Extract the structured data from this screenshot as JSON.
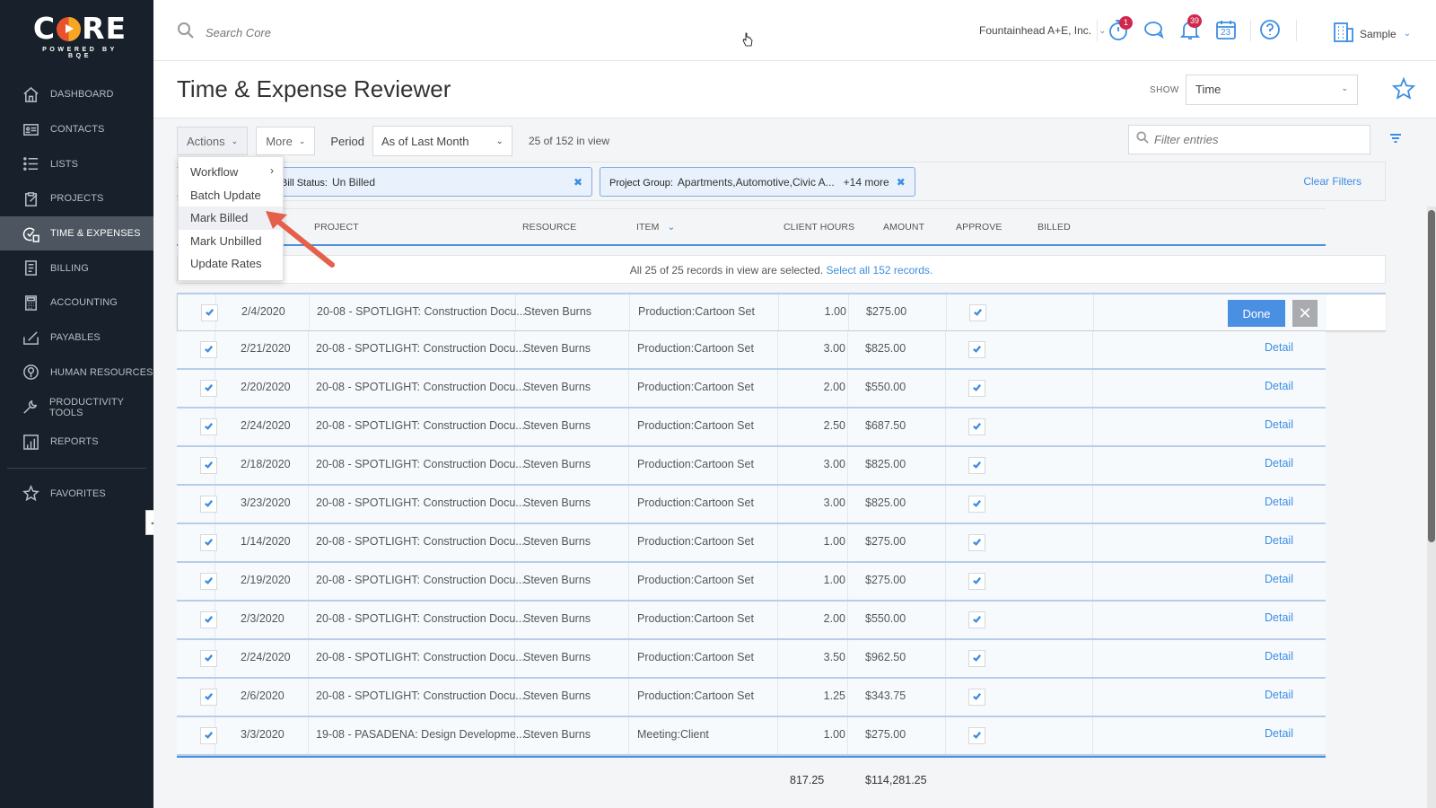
{
  "sidebar": {
    "logo": {
      "word_left": "C",
      "word_right": "RE",
      "tagline": "POWERED BY BQE"
    },
    "items": [
      {
        "label": "DASHBOARD",
        "icon": "home-icon",
        "active": false
      },
      {
        "label": "CONTACTS",
        "icon": "contact-card-icon",
        "active": false
      },
      {
        "label": "LISTS",
        "icon": "list-icon",
        "active": false
      },
      {
        "label": "PROJECTS",
        "icon": "clipboard-edit-icon",
        "active": false
      },
      {
        "label": "TIME & EXPENSES",
        "icon": "clock-dollar-icon",
        "active": true
      },
      {
        "label": "BILLING",
        "icon": "invoice-icon",
        "active": false
      },
      {
        "label": "ACCOUNTING",
        "icon": "calculator-icon",
        "active": false
      },
      {
        "label": "PAYABLES",
        "icon": "check-pen-icon",
        "active": false
      },
      {
        "label": "HUMAN RESOURCES",
        "icon": "person-circle-icon",
        "active": false
      },
      {
        "label": "PRODUCTIVITY TOOLS",
        "icon": "wrench-icon",
        "active": false
      },
      {
        "label": "REPORTS",
        "icon": "chart-icon",
        "active": false
      }
    ],
    "favorites": {
      "label": "FAVORITES",
      "icon": "star-icon"
    }
  },
  "topbar": {
    "search_placeholder": "Search Core",
    "company": "Fountainhead A+E, Inc.",
    "timer_badge": "1",
    "notifications_badge": "39",
    "calendar_day": "23",
    "user": "Sample"
  },
  "header": {
    "title": "Time & Expense Reviewer",
    "show_label": "SHOW",
    "show_value": "Time"
  },
  "toolbar": {
    "actions_label": "Actions",
    "more_label": "More",
    "period_label": "Period",
    "period_value": "As of Last Month",
    "in_view": "25 of 152 in view",
    "filter_placeholder": "Filter entries"
  },
  "filters": {
    "chips": [
      {
        "label": "Bill Status:",
        "value": "Un Billed",
        "extra": ""
      },
      {
        "label": "Project Group:",
        "value": "Apartments,Automotive,Civic A...",
        "extra": "+14 more"
      }
    ],
    "clear_label": "Clear Filters"
  },
  "actions_menu": {
    "items": [
      {
        "label": "Workflow",
        "submenu": true
      },
      {
        "label": "Batch Update",
        "submenu": false
      },
      {
        "label": "Mark Billed",
        "submenu": false,
        "highlighted": true
      },
      {
        "label": "Mark Unbilled",
        "submenu": false
      },
      {
        "label": "Update Rates",
        "submenu": false
      }
    ]
  },
  "table": {
    "columns": [
      "PROJECT",
      "RESOURCE",
      "ITEM",
      "CLIENT HOURS",
      "AMOUNT",
      "APPROVE",
      "BILLED"
    ],
    "selection_message": "All 25 of 25 records in view are selected.",
    "select_all_link": "Select all 152 records.",
    "done_label": "Done",
    "detail_label": "Detail",
    "rows": [
      {
        "date": "2/4/2020",
        "project": "20-08 - SPOTLIGHT: Construction Docu...",
        "resource": "Steven Burns",
        "item": "Production:Cartoon Set",
        "hours": "1.00",
        "amount": "$275.00",
        "selected": true,
        "approved": true
      },
      {
        "date": "2/21/2020",
        "project": "20-08 - SPOTLIGHT: Construction Docu...",
        "resource": "Steven Burns",
        "item": "Production:Cartoon Set",
        "hours": "3.00",
        "amount": "$825.00",
        "selected": true,
        "approved": true
      },
      {
        "date": "2/20/2020",
        "project": "20-08 - SPOTLIGHT: Construction Docu...",
        "resource": "Steven Burns",
        "item": "Production:Cartoon Set",
        "hours": "2.00",
        "amount": "$550.00",
        "selected": true,
        "approved": true
      },
      {
        "date": "2/24/2020",
        "project": "20-08 - SPOTLIGHT: Construction Docu...",
        "resource": "Steven Burns",
        "item": "Production:Cartoon Set",
        "hours": "2.50",
        "amount": "$687.50",
        "selected": true,
        "approved": true
      },
      {
        "date": "2/18/2020",
        "project": "20-08 - SPOTLIGHT: Construction Docu...",
        "resource": "Steven Burns",
        "item": "Production:Cartoon Set",
        "hours": "3.00",
        "amount": "$825.00",
        "selected": true,
        "approved": true
      },
      {
        "date": "3/23/2020",
        "project": "20-08 - SPOTLIGHT: Construction Docu...",
        "resource": "Steven Burns",
        "item": "Production:Cartoon Set",
        "hours": "3.00",
        "amount": "$825.00",
        "selected": true,
        "approved": true
      },
      {
        "date": "1/14/2020",
        "project": "20-08 - SPOTLIGHT: Construction Docu...",
        "resource": "Steven Burns",
        "item": "Production:Cartoon Set",
        "hours": "1.00",
        "amount": "$275.00",
        "selected": true,
        "approved": true
      },
      {
        "date": "2/19/2020",
        "project": "20-08 - SPOTLIGHT: Construction Docu...",
        "resource": "Steven Burns",
        "item": "Production:Cartoon Set",
        "hours": "1.00",
        "amount": "$275.00",
        "selected": true,
        "approved": true
      },
      {
        "date": "2/3/2020",
        "project": "20-08 - SPOTLIGHT: Construction Docu...",
        "resource": "Steven Burns",
        "item": "Production:Cartoon Set",
        "hours": "2.00",
        "amount": "$550.00",
        "selected": true,
        "approved": true
      },
      {
        "date": "2/24/2020",
        "project": "20-08 - SPOTLIGHT: Construction Docu...",
        "resource": "Steven Burns",
        "item": "Production:Cartoon Set",
        "hours": "3.50",
        "amount": "$962.50",
        "selected": true,
        "approved": true
      },
      {
        "date": "2/6/2020",
        "project": "20-08 - SPOTLIGHT: Construction Docu...",
        "resource": "Steven Burns",
        "item": "Production:Cartoon Set",
        "hours": "1.25",
        "amount": "$343.75",
        "selected": true,
        "approved": true
      },
      {
        "date": "3/3/2020",
        "project": "19-08 - PASADENA: Design Developme...",
        "resource": "Steven Burns",
        "item": "Meeting:Client",
        "hours": "1.00",
        "amount": "$275.00",
        "selected": true,
        "approved": true
      }
    ],
    "totals": {
      "hours": "817.25",
      "amount": "$114,281.25"
    }
  },
  "colors": {
    "accent": "#3b8ee3",
    "sidebar_bg": "#18212b",
    "badge": "#d0284c",
    "annotation_arrow": "#e4604a"
  }
}
